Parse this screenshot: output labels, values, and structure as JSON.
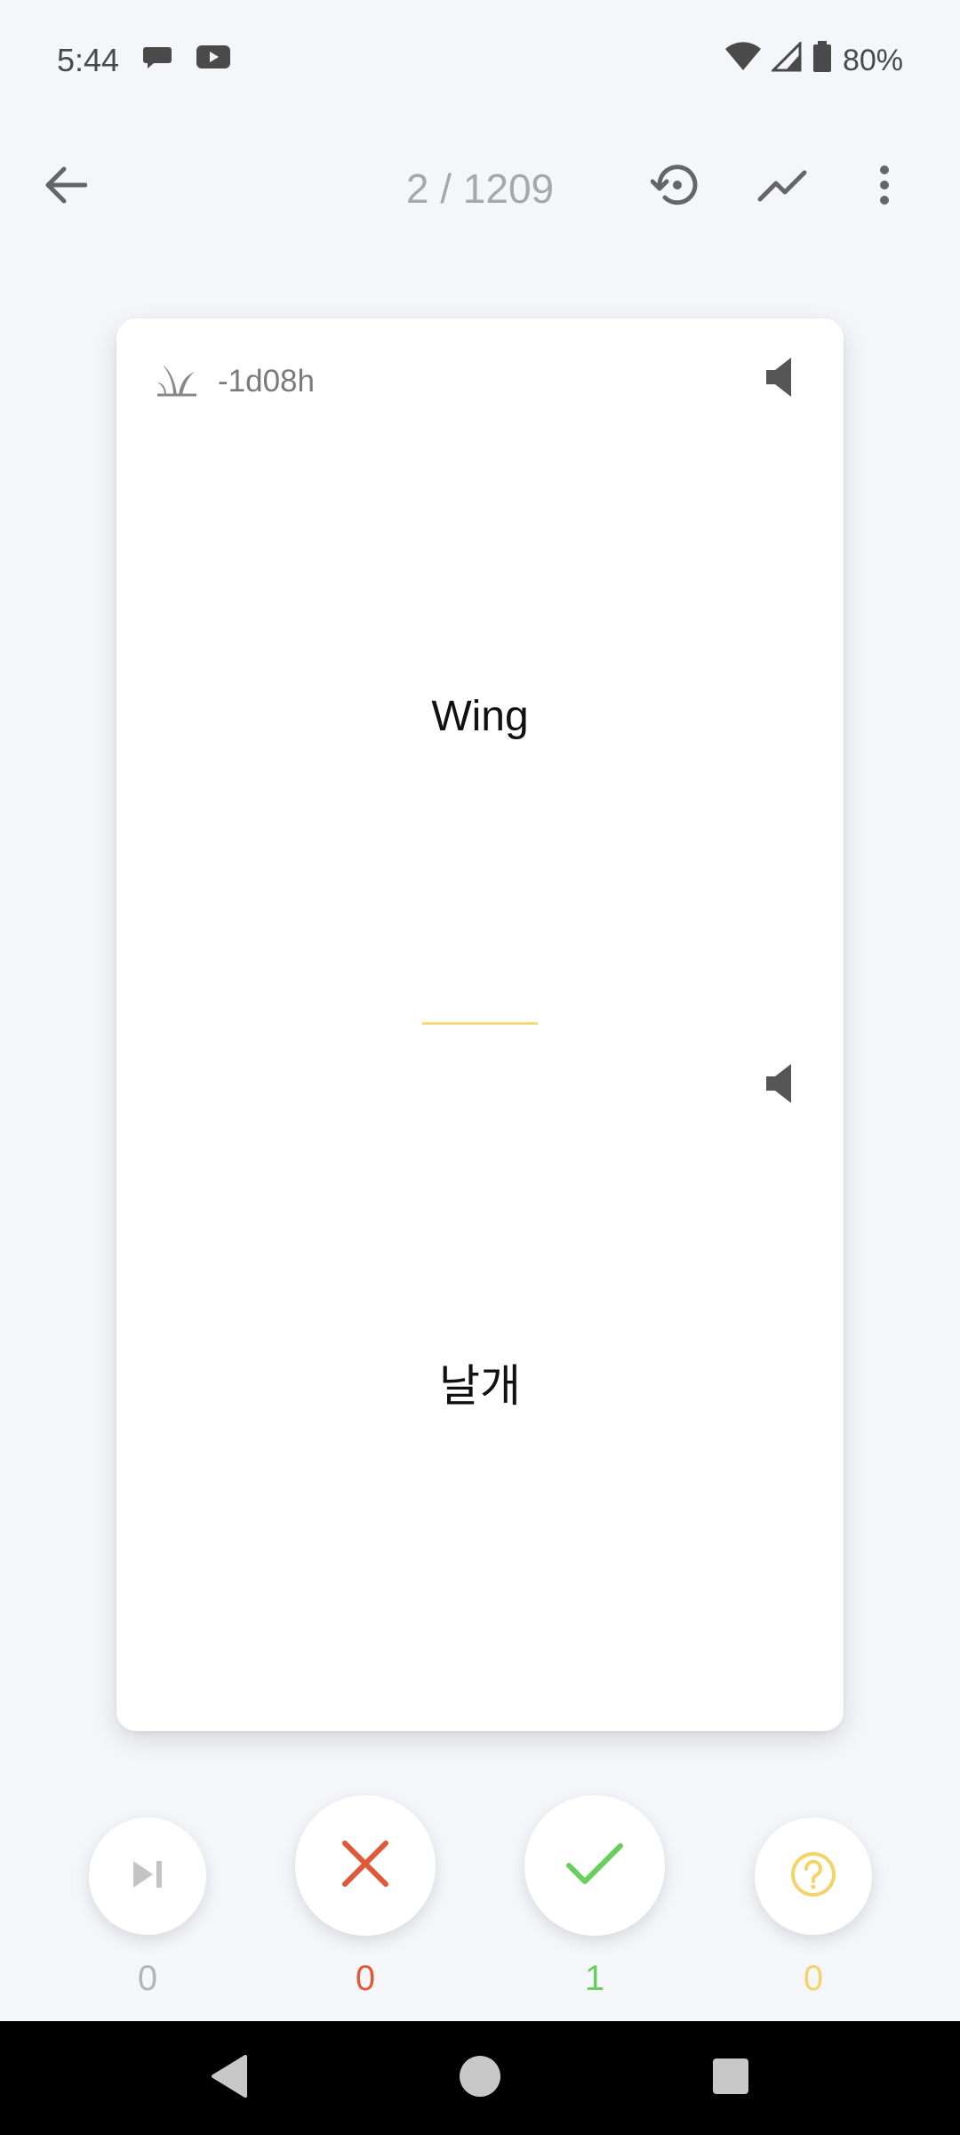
{
  "status_bar": {
    "time": "5:44",
    "battery_percent": "80%",
    "icons": [
      "chat-bubble-icon",
      "youtube-icon",
      "wifi-icon",
      "signal-icon",
      "battery-icon"
    ]
  },
  "toolbar": {
    "counter": "2 / 1209",
    "icons": [
      "back-arrow-icon",
      "history-icon",
      "chart-line-icon",
      "more-vert-icon"
    ]
  },
  "card": {
    "meta_text": "-1d08h",
    "front": "Wing",
    "back": "날개",
    "divider_color": "#f3dd7a"
  },
  "actions": {
    "skip": {
      "count": "0",
      "color": "#b5b5b5"
    },
    "wrong": {
      "count": "0",
      "color": "#e05a3a"
    },
    "correct": {
      "count": "1",
      "color": "#67cf5a"
    },
    "unsure": {
      "count": "0",
      "color": "#f3d46a"
    }
  }
}
